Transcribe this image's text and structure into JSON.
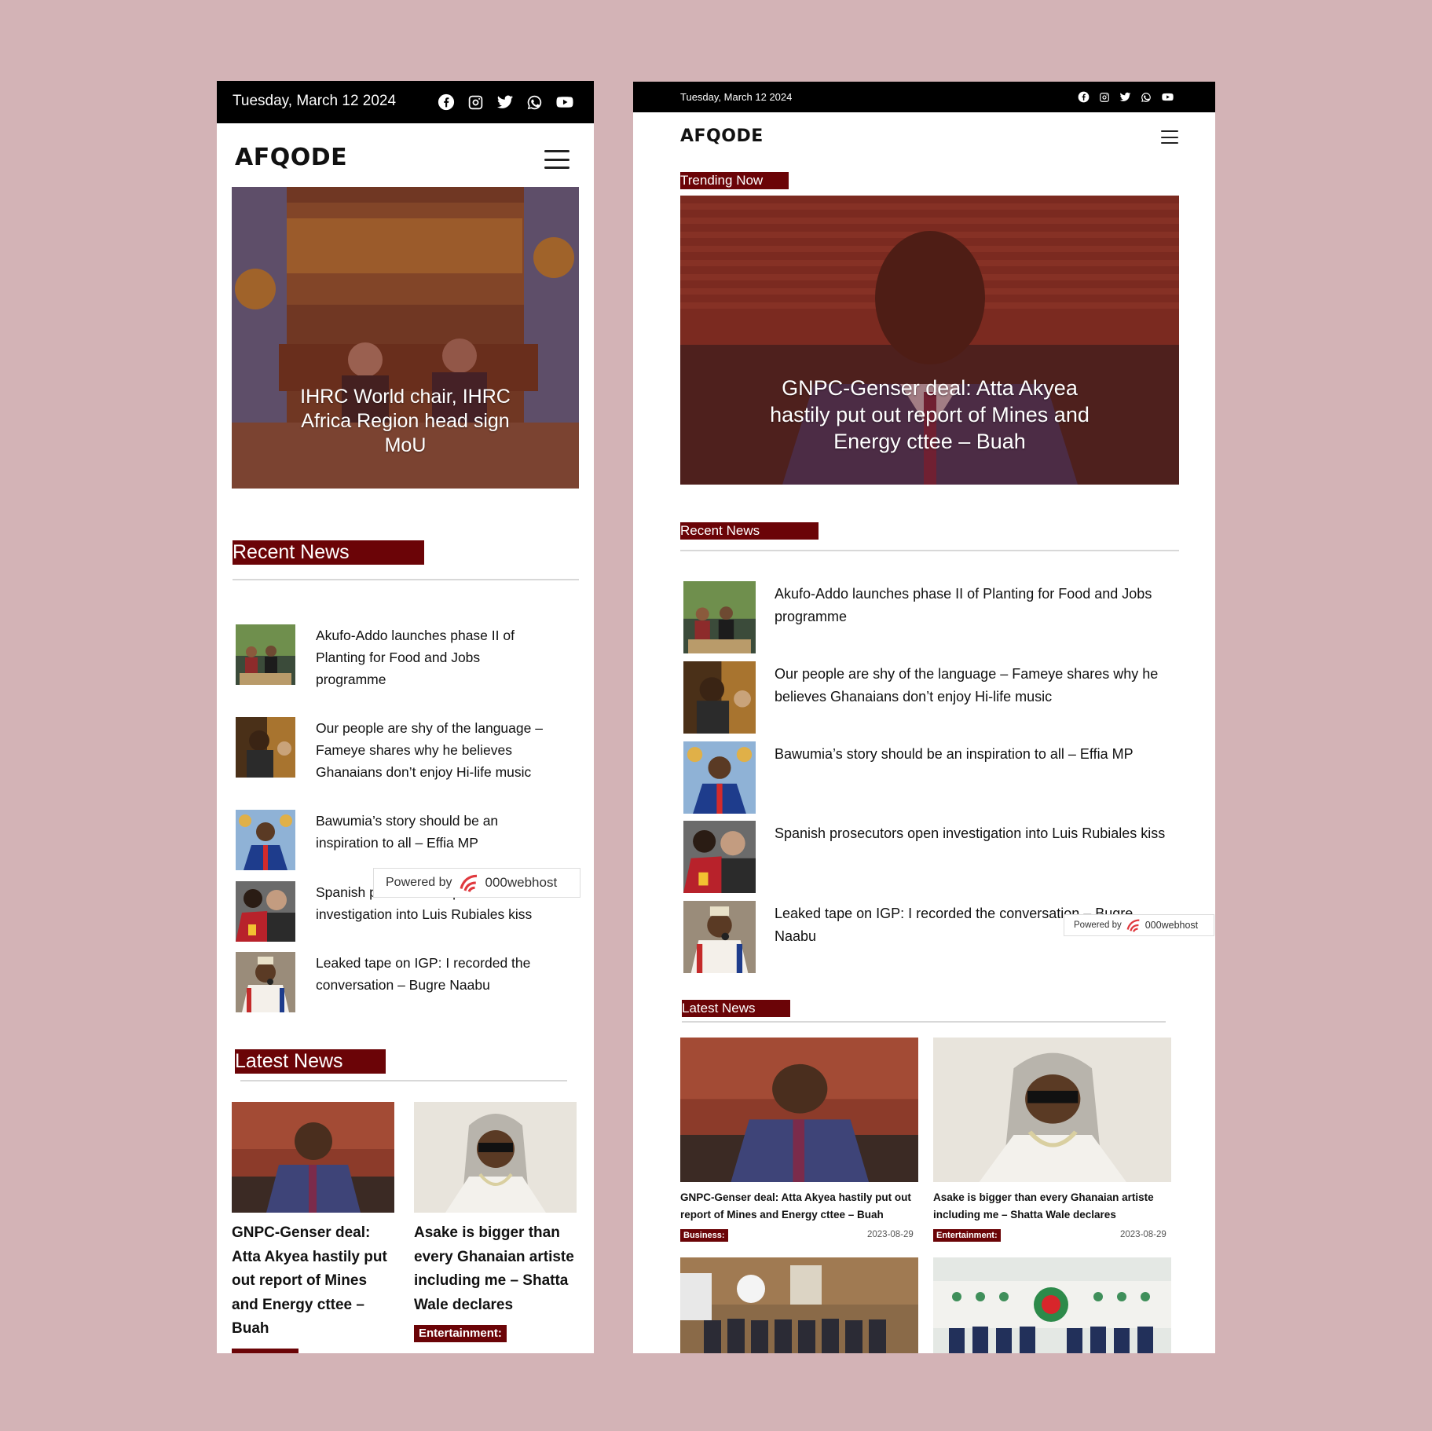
{
  "left": {
    "date": "Tuesday, March 12 2024",
    "logo": "AFQODE",
    "hero_caption": "IHRC World chair, IHRC Africa Region head sign MoU",
    "recent_label": "Recent News",
    "recent": [
      {
        "title": "Akufo-Addo launches phase II of Planting for Food and Jobs programme"
      },
      {
        "title": "Our people are shy of the language – Fameye shares why he believes Ghanaians don’t enjoy Hi-life music"
      },
      {
        "title": "Bawumia’s story should be an inspiration to all – Effia MP"
      },
      {
        "title": "Spanish prosecutors open investigation into Luis Rubiales kiss"
      },
      {
        "title": "Leaked tape on IGP: I recorded the conversation – Bugre Naabu"
      }
    ],
    "latest_label": "Latest News",
    "latest": [
      {
        "title": "GNPC-Genser deal: Atta Akyea hastily put out report of Mines and Energy cttee – Buah",
        "badge": ""
      },
      {
        "title": "Asake is bigger than every Ghanaian artiste including me – Shatta Wale declares",
        "badge": "Entertainment:"
      }
    ],
    "powered_by": "Powered by",
    "host": "000webhost"
  },
  "right": {
    "date": "Tuesday, March 12 2024",
    "logo": "AFQODE",
    "trending_label": "Trending Now",
    "hero_caption": "GNPC-Genser deal: Atta Akyea hastily put out report of Mines and Energy cttee – Buah",
    "recent_label": "Recent News",
    "recent": [
      {
        "title": "Akufo-Addo launches phase II of Planting for Food and Jobs programme"
      },
      {
        "title": "Our people are shy of the language – Fameye shares why he believes Ghanaians don’t enjoy Hi-life music"
      },
      {
        "title": "Bawumia’s story should be an inspiration to all – Effia MP"
      },
      {
        "title": "Spanish prosecutors open investigation into Luis Rubiales kiss"
      },
      {
        "title": "Leaked tape on IGP: I recorded the conversation – Bugre Naabu"
      }
    ],
    "latest_label": "Latest News",
    "latest": [
      {
        "title": "GNPC-Genser deal: Atta Akyea hastily put out report of Mines and Energy cttee – Buah",
        "badge": "Business:",
        "date": "2023-08-29"
      },
      {
        "title": "Asake is bigger than every Ghanaian artiste including me – Shatta Wale declares",
        "badge": "Entertainment:",
        "date": "2023-08-29"
      }
    ],
    "powered_by": "Powered by",
    "host": "000webhost"
  },
  "icons": [
    "facebook-icon",
    "instagram-icon",
    "twitter-icon",
    "whatsapp-icon",
    "youtube-icon",
    "menu-icon"
  ],
  "colors": {
    "background": "#d3b3b6",
    "accent": "#6b0407",
    "topbar": "#000000"
  }
}
